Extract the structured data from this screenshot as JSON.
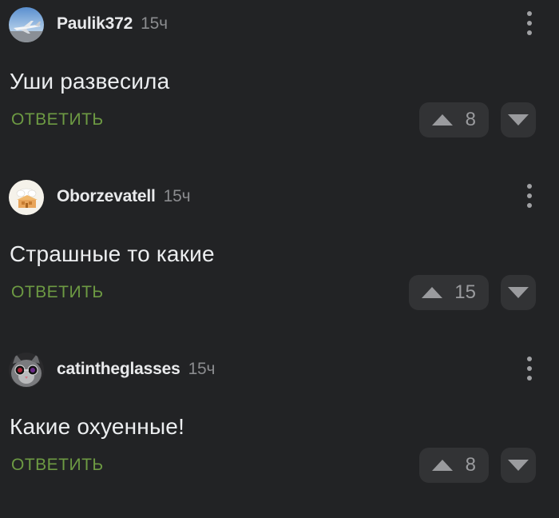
{
  "comments": [
    {
      "username": "Paulik372",
      "time": "15ч",
      "text": "Уши развесила",
      "reply_label": "ОТВЕТИТЬ",
      "votes": "8",
      "avatar_icon": "airplane-avatar"
    },
    {
      "username": "Oborzevatell",
      "time": "15ч",
      "text": "Страшные то какие",
      "reply_label": "ОТВЕТИТЬ",
      "votes": "15",
      "avatar_icon": "house-avatar"
    },
    {
      "username": "catintheglasses",
      "time": "15ч",
      "text": "Какие охуенные!",
      "reply_label": "ОТВЕТИТЬ",
      "votes": "8",
      "avatar_icon": "cat-glasses-avatar"
    }
  ],
  "colors": {
    "background": "#222325",
    "reply": "#6d9a43",
    "button_bg": "#323335",
    "muted": "#8b8c8f"
  }
}
